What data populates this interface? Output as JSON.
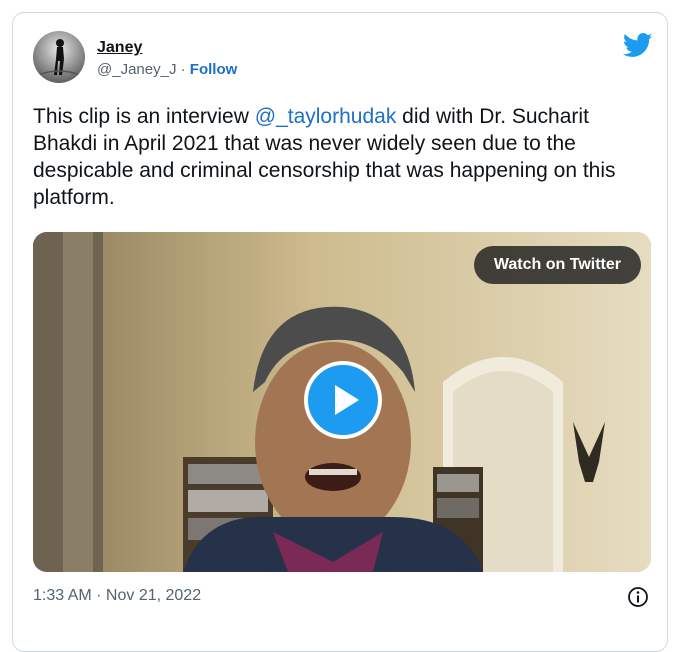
{
  "tweet": {
    "author_name": "Janey",
    "author_handle": "@_Janey_J",
    "separator": "·",
    "follow_label": "Follow",
    "text_before": "This clip is an interview ",
    "mention": "@_taylorhudak",
    "text_after": " did with Dr. Sucharit Bhakdi in April 2021 that was never widely seen due to the despicable and criminal censorship that was happening on this platform.",
    "timestamp": "1:33 AM · Nov 21, 2022"
  },
  "media": {
    "watch_label": "Watch on Twitter"
  },
  "icons": {
    "brand": "twitter-bird-icon",
    "play": "play-icon",
    "info": "info-icon"
  },
  "colors": {
    "link": "#1d70c4",
    "twitter_blue": "#1d9bf0",
    "muted": "#536471",
    "border": "#cfd9de"
  }
}
